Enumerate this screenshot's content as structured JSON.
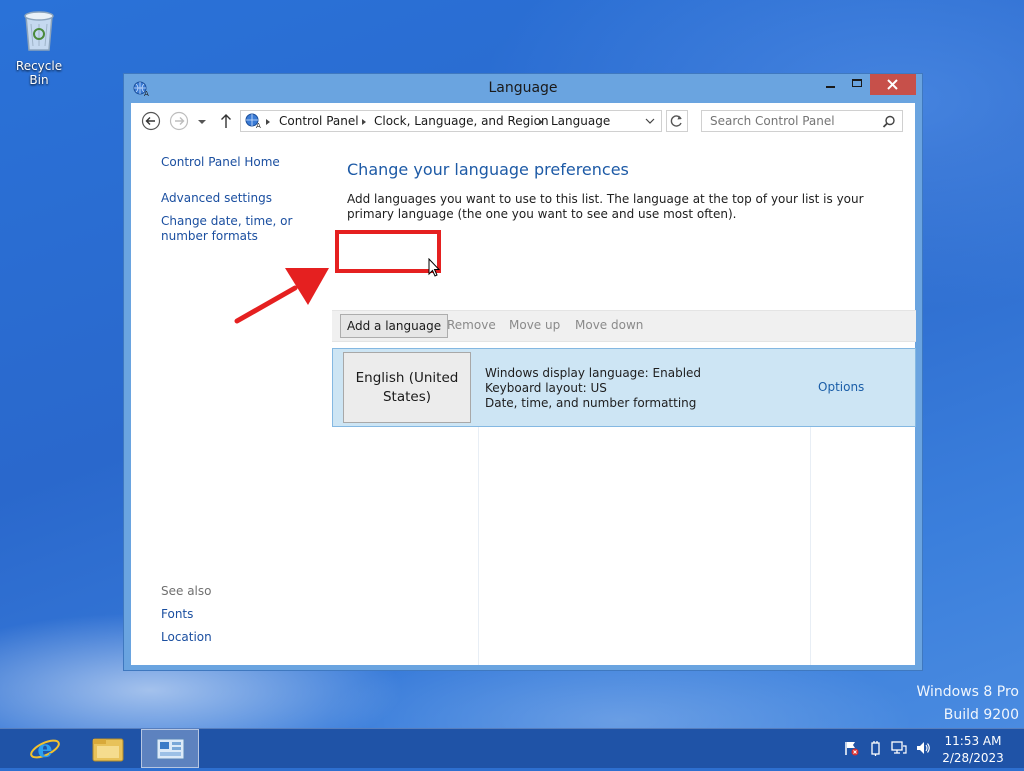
{
  "desktop": {
    "recycle_bin_label": "Recycle Bin",
    "watermark_line1": "Windows 8 Pro",
    "watermark_line2": "Build 9200"
  },
  "window": {
    "title": "Language",
    "address": {
      "crumbs": [
        "Control Panel",
        "Clock, Language, and Region",
        "Language"
      ]
    },
    "search_placeholder": "Search Control Panel",
    "left_pane": {
      "home": "Control Panel Home",
      "links": [
        "Advanced settings",
        "Change date, time, or number formats"
      ],
      "see_also_label": "See also",
      "see_also_links": [
        "Fonts",
        "Location"
      ]
    },
    "main": {
      "heading": "Change your language preferences",
      "description": "Add languages you want to use to this list. The language at the top of your list is your primary language (the one you want to see and use most often).",
      "toolbar": {
        "add": "Add a language",
        "remove": "Remove",
        "move_up": "Move up",
        "move_down": "Move down"
      },
      "languages": [
        {
          "name": "English (United States)",
          "details": [
            "Windows display language: Enabled",
            "Keyboard layout: US",
            "Date, time, and number formatting"
          ],
          "options": "Options"
        }
      ]
    }
  },
  "taskbar": {
    "apps": [
      "internet-explorer-icon",
      "file-explorer-icon",
      "control-panel-icon"
    ],
    "clock_time": "11:53 AM",
    "clock_date": "2/28/2023"
  },
  "colors": {
    "accent_link": "#1b4fa0",
    "annotation_red": "#e52020",
    "selection_bg": "#cde5f4"
  }
}
